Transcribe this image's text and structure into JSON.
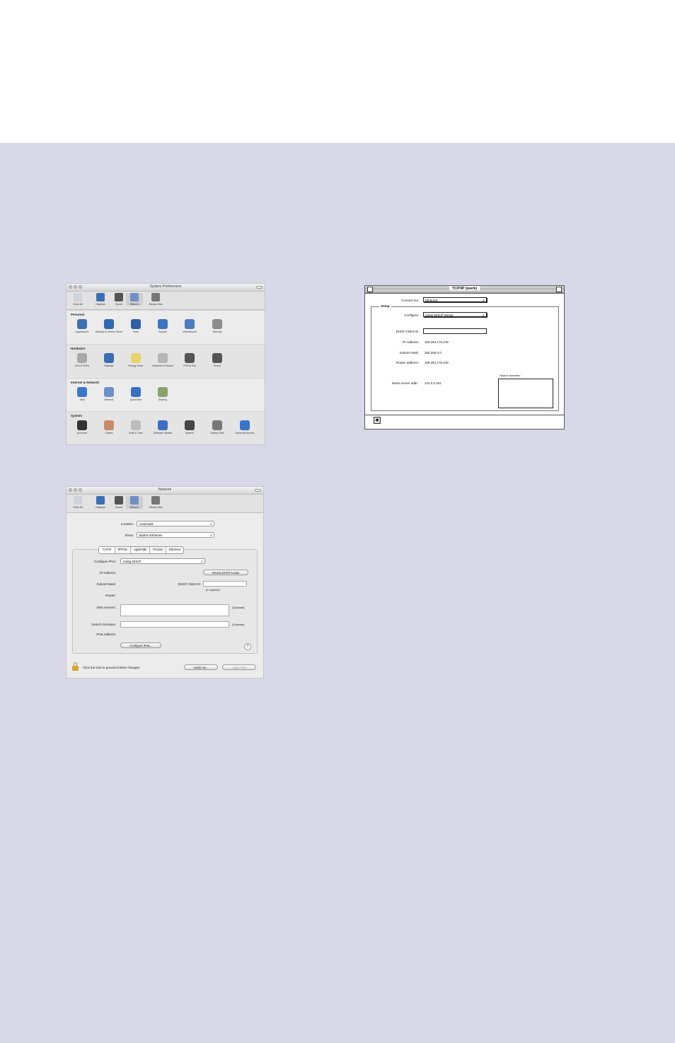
{
  "sysprefs": {
    "title": "System Preferences",
    "toolbar": [
      {
        "label": "Show All",
        "icon": "grid-icon",
        "color": "#cfd3da"
      },
      {
        "label": "Displays",
        "icon": "display-icon",
        "color": "#3a6fb5"
      },
      {
        "label": "Sound",
        "icon": "speaker-icon",
        "color": "#555555"
      },
      {
        "label": "Network",
        "icon": "globe-icon",
        "color": "#6f8fc8"
      },
      {
        "label": "Startup Disk",
        "icon": "disk-icon",
        "color": "#777777"
      }
    ],
    "sections": [
      {
        "title": "Personal",
        "items": [
          {
            "label": "Appearance",
            "icon": "appearance-icon",
            "color": "#3f6fb0"
          },
          {
            "label": "Desktop & Screen Saver",
            "icon": "desktop-icon",
            "color": "#2e69b3"
          },
          {
            "label": "Dock",
            "icon": "dock-icon",
            "color": "#2d5fa6"
          },
          {
            "label": "Exposé",
            "icon": "expose-icon",
            "color": "#3b74c2"
          },
          {
            "label": "International",
            "icon": "flag-icon",
            "color": "#4a7cc0"
          },
          {
            "label": "Security",
            "icon": "security-icon",
            "color": "#8c8c8c"
          }
        ]
      },
      {
        "title": "Hardware",
        "items": [
          {
            "label": "CDs & DVDs",
            "icon": "cd-icon",
            "color": "#a9a9a9"
          },
          {
            "label": "Displays",
            "icon": "display-icon",
            "color": "#3a6fb5"
          },
          {
            "label": "Energy Saver",
            "icon": "bulb-icon",
            "color": "#e9d36c"
          },
          {
            "label": "Keyboard & Mouse",
            "icon": "keyboard-icon",
            "color": "#b5b5b5"
          },
          {
            "label": "Print & Fax",
            "icon": "printer-icon",
            "color": "#555555"
          },
          {
            "label": "Sound",
            "icon": "speaker-icon",
            "color": "#555555"
          }
        ]
      },
      {
        "title": "Internet & Network",
        "items": [
          {
            "label": ".Mac",
            "icon": "mac-globe-icon",
            "color": "#3a78c8"
          },
          {
            "label": "Network",
            "icon": "globe-icon",
            "color": "#6f8fc8"
          },
          {
            "label": "QuickTime",
            "icon": "quicktime-icon",
            "color": "#3b6ec5"
          },
          {
            "label": "Sharing",
            "icon": "sharing-icon",
            "color": "#8aa36a"
          }
        ]
      },
      {
        "title": "System",
        "items": [
          {
            "label": "Accounts",
            "icon": "accounts-icon",
            "color": "#333333"
          },
          {
            "label": "Classic",
            "icon": "classic-icon",
            "color": "#c98a6a"
          },
          {
            "label": "Date & Time",
            "icon": "clock-icon",
            "color": "#bcbcbc"
          },
          {
            "label": "Software Update",
            "icon": "update-icon",
            "color": "#3d6fc0"
          },
          {
            "label": "Speech",
            "icon": "microphone-icon",
            "color": "#444444"
          },
          {
            "label": "Startup Disk",
            "icon": "disk-icon",
            "color": "#777777"
          },
          {
            "label": "Universal Access",
            "icon": "universal-access-icon",
            "color": "#3a74c8"
          }
        ]
      }
    ]
  },
  "tcpip": {
    "title": "TCP/IP (werk)",
    "connect_via_label": "Connect via:",
    "connect_via_value": "Ethernet",
    "setup_label": "Setup",
    "configure_label": "Configure:",
    "configure_value": "Using DHCP Server",
    "dhcp_client_id_label": "DHCP Client ID:",
    "dhcp_client_id_value": "",
    "ip_address_label": "IP Address:",
    "ip_address_value": "169.254.175.249",
    "subnet_mask_label": "Subnet mask:",
    "subnet_mask_value": "255.255.0.0",
    "router_address_label": "Router address:",
    "router_address_value": "169.254.175.249",
    "name_server_label": "Name server addr.:",
    "name_server_value": "224.0.0.251",
    "search_domains_label": "Search domains:"
  },
  "network": {
    "title": "Network",
    "toolbar": [
      {
        "label": "Show All",
        "icon": "grid-icon",
        "color": "#cfd3da"
      },
      {
        "label": "Displays",
        "icon": "display-icon",
        "color": "#3a6fb5"
      },
      {
        "label": "Sound",
        "icon": "speaker-icon",
        "color": "#555555"
      },
      {
        "label": "Network",
        "icon": "globe-icon",
        "color": "#6f8fc8"
      },
      {
        "label": "Startup Disk",
        "icon": "disk-icon",
        "color": "#777777"
      }
    ],
    "location_label": "Location:",
    "location_value": "Automatic",
    "show_label": "Show:",
    "show_value": "Built-in Ethernet",
    "tabs": [
      "TCP/IP",
      "PPPoE",
      "AppleTalk",
      "Proxies",
      "Ethernet"
    ],
    "configure_label": "Configure IPv4:",
    "configure_value": "Using DHCP",
    "ip_address_label": "IP Address:",
    "renew_button": "Renew DHCP Lease",
    "subnet_mask_label": "Subnet Mask:",
    "dhcp_client_id_label": "DHCP Client ID:",
    "if_required": "(If required)",
    "router_label": "Router:",
    "dns_servers_label": "DNS Servers:",
    "optional_1": "(Optional)",
    "search_domains_label": "Search Domains:",
    "optional_2": "(Optional)",
    "ipv6_label": "IPv6 Address:",
    "configure_ipv6_button": "Configure IPv6...",
    "help": "?",
    "lock_text": "Click the lock to prevent further changes.",
    "assist_button": "Assist me...",
    "apply_button": "Apply Now"
  }
}
